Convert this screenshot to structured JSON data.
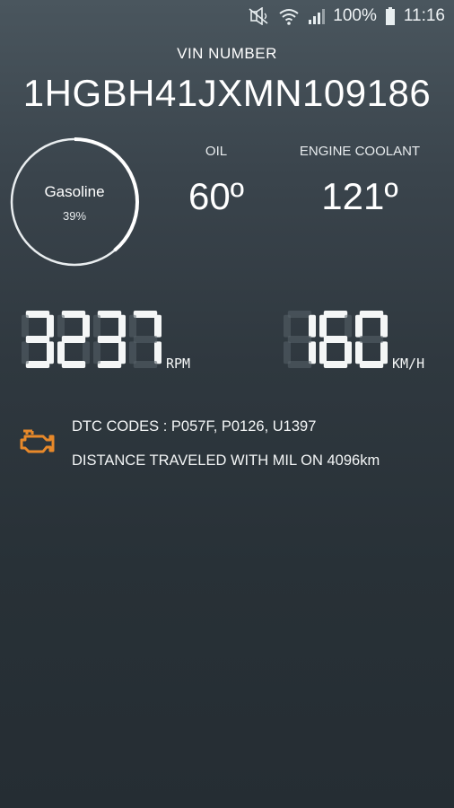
{
  "status_bar": {
    "battery": "100%",
    "time": "11:16",
    "icons": [
      "mute-vibrate-icon",
      "wifi-icon",
      "signal-icon",
      "battery-icon"
    ]
  },
  "vin": {
    "label": "VIN NUMBER",
    "number": "1HGBH41JXMN109186"
  },
  "fuel_gauge": {
    "label": "Gasoline",
    "percent_text": "39%",
    "level": 0.39
  },
  "temperatures": {
    "oil": {
      "label": "OIL",
      "value": "60º"
    },
    "coolant": {
      "label": "ENGINE COOLANT",
      "value": "121º"
    }
  },
  "rpm": {
    "value": "3237",
    "unit": "RPM"
  },
  "speed": {
    "value": "160",
    "unit": "KM/H"
  },
  "diagnostics": {
    "dtc_codes": "DTC CODES : P057F, P0126, U1397",
    "distance_mil": "DISTANCE TRAVELED WITH MIL ON 4096km"
  },
  "colors": {
    "accent_orange": "#e8892a",
    "text": "#ffffff",
    "background_top": "#4a565e",
    "background_bottom": "#252d33"
  }
}
